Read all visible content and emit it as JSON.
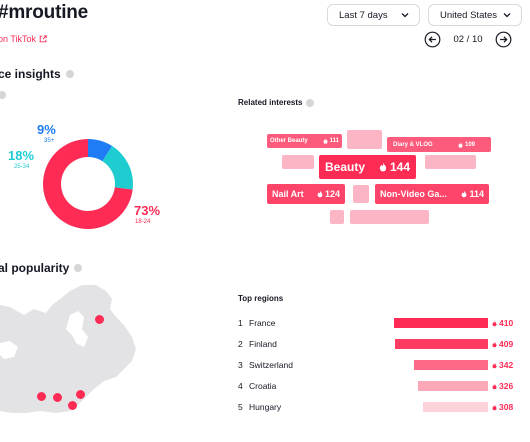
{
  "header": {
    "title": "#mroutine",
    "view_link": "on TikTok",
    "period_select": "Last 7 days",
    "country_select": "United States",
    "page": "02 / 10"
  },
  "audience": {
    "title": "ce insights",
    "age_segments": [
      {
        "label": "9%",
        "sub": "35+",
        "value": 9,
        "color": "#1f7cf5"
      },
      {
        "label": "18%",
        "sub": "25-34",
        "value": 18,
        "color": "#1fcdd1"
      },
      {
        "label": "73%",
        "sub": "18-24",
        "value": 73,
        "color": "#fe2c55"
      }
    ]
  },
  "related": {
    "title": "Related interests",
    "chips": [
      {
        "label": "Other Beauty",
        "value": "111",
        "tier": 2
      },
      {
        "label": "Diary & VLOG",
        "value": "109",
        "tier": 2
      },
      {
        "label": "Beauty",
        "value": "144",
        "tier": 1
      },
      {
        "label": "Nail Art",
        "value": "124",
        "tier": 2
      },
      {
        "label": "Non-Video Ga...",
        "value": "114",
        "tier": 2
      }
    ]
  },
  "popularity": {
    "title": "al popularity",
    "top_regions_title": "Top regions",
    "regions": [
      {
        "rank": "1",
        "name": "France",
        "value": "410",
        "share": 1.0,
        "color": "#fe2c55"
      },
      {
        "rank": "2",
        "name": "Finland",
        "value": "409",
        "share": 0.99,
        "color": "#fe3c62"
      },
      {
        "rank": "3",
        "name": "Switzerland",
        "value": "342",
        "share": 0.79,
        "color": "#fd6a87"
      },
      {
        "rank": "4",
        "name": "Croatia",
        "value": "326",
        "share": 0.74,
        "color": "#fca8b8"
      },
      {
        "rank": "5",
        "name": "Hungary",
        "value": "308",
        "share": 0.69,
        "color": "#fdd2da"
      }
    ]
  },
  "colors": {
    "accent": "#fe2c55",
    "teal": "#1fcdd1",
    "blue": "#1f7cf5",
    "map": "#e3e3e5"
  }
}
